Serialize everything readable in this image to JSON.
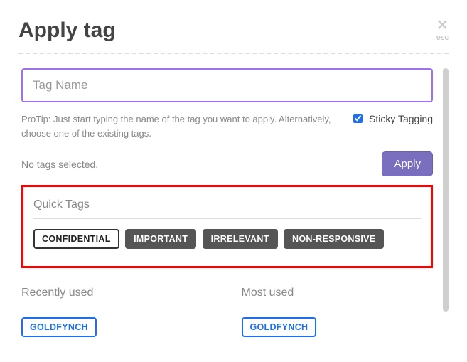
{
  "header": {
    "title": "Apply tag",
    "close_label": "esc"
  },
  "input": {
    "placeholder": "Tag Name"
  },
  "protip": "ProTip: Just start typing the name of the tag you want to apply. Alternatively, choose one of the existing tags.",
  "sticky": {
    "label": "Sticky Tagging",
    "checked": true
  },
  "status": {
    "no_tags": "No tags selected."
  },
  "apply_label": "Apply",
  "quick_tags": {
    "title": "Quick Tags",
    "items": [
      "CONFIDENTIAL",
      "IMPORTANT",
      "IRRELEVANT",
      "NON-RESPONSIVE"
    ]
  },
  "recent": {
    "title": "Recently used",
    "items": [
      "GOLDFYNCH"
    ]
  },
  "most": {
    "title": "Most used",
    "items": [
      "GOLDFYNCH"
    ]
  }
}
